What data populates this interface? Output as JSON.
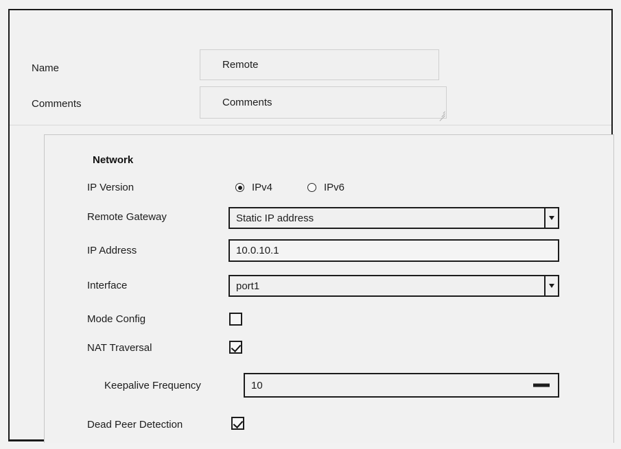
{
  "form": {
    "name": {
      "label": "Name",
      "value": "Remote"
    },
    "comments": {
      "label": "Comments",
      "value": "Comments",
      "resize_handle": "resize-grip-icon"
    }
  },
  "network": {
    "heading": "Network",
    "ip_version": {
      "label": "IP Version",
      "selected": "IPv4",
      "options": [
        "IPv4",
        "IPv6"
      ]
    },
    "remote_gateway": {
      "label": "Remote Gateway",
      "value": "Static IP address",
      "dropdown_icon": "chevron-down-icon"
    },
    "ip_address": {
      "label": "IP Address",
      "value": "10.0.10.1"
    },
    "interface": {
      "label": "Interface",
      "value": "port1",
      "dropdown_icon": "chevron-down-icon"
    },
    "mode_config": {
      "label": "Mode Config",
      "checked": false
    },
    "nat_traversal": {
      "label": "NAT Traversal",
      "checked": true
    },
    "keepalive_frequency": {
      "label": "Keepalive Frequency",
      "value": "10",
      "decrement_icon": "minus-icon"
    },
    "dead_peer_detection": {
      "label": "Dead Peer Detection",
      "checked": true
    }
  },
  "colors": {
    "page_background": "#f2f2f2",
    "panel_background": "#f1f1f1",
    "frame_border": "#1a1a1a",
    "soft_border": "#cfcfcf",
    "text": "#1c1c1c"
  }
}
